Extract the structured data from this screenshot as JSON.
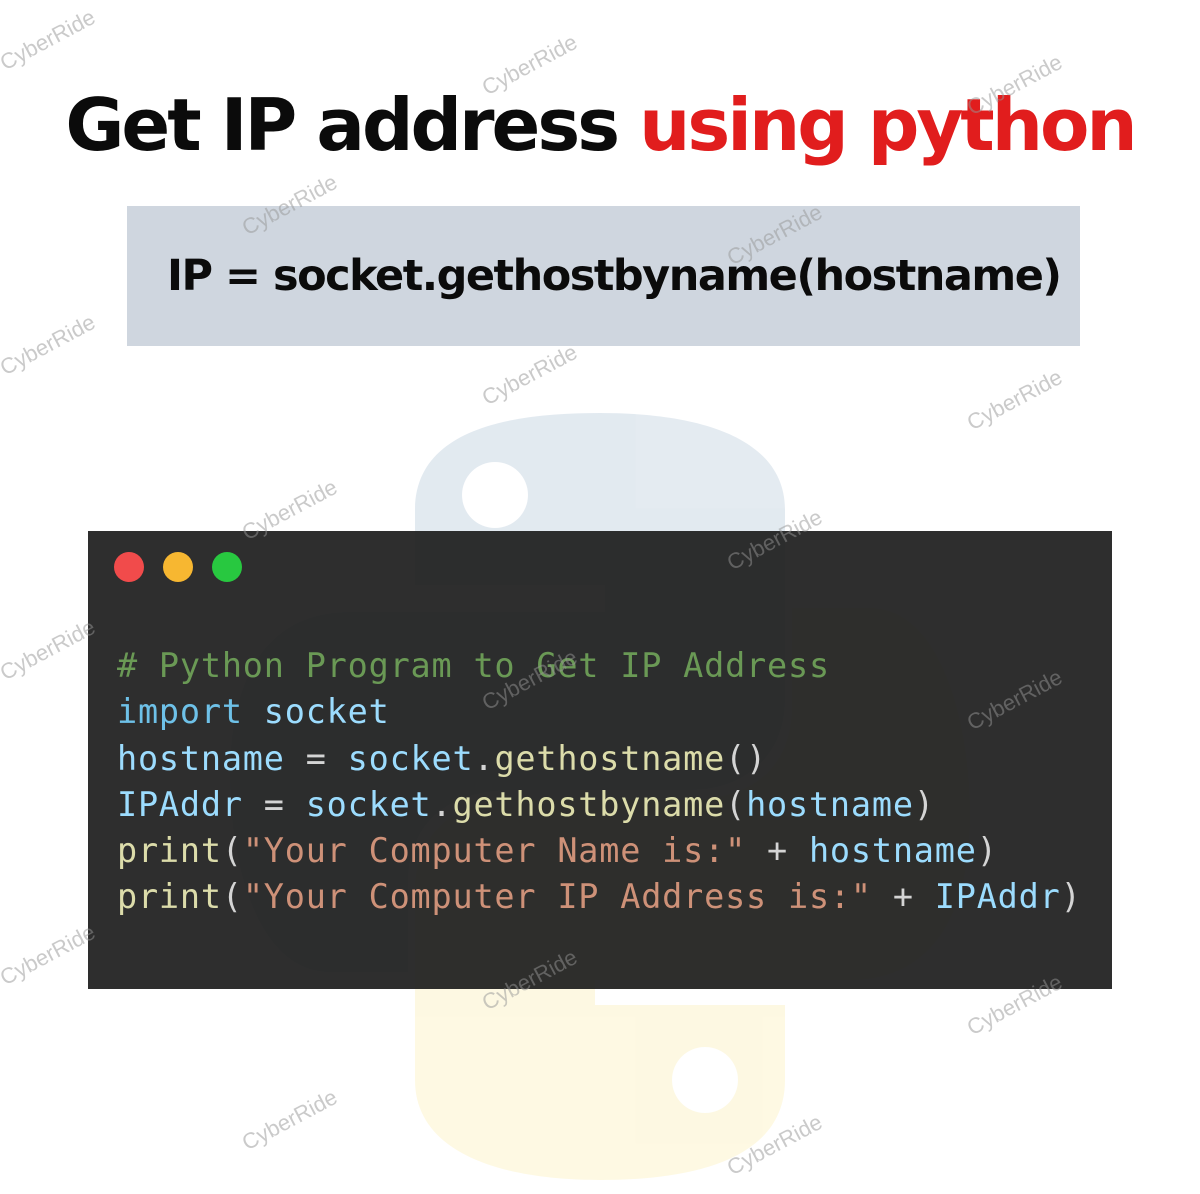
{
  "title": {
    "main": "Get IP address",
    "accent": "using python"
  },
  "formula": "IP = socket.gethostbyname(hostname)",
  "editor": {
    "code": [
      [
        {
          "t": "# Python Program to Get IP Address",
          "c": "cm"
        }
      ],
      [
        {
          "t": "import",
          "c": "kw"
        },
        {
          "t": " ",
          "c": "op"
        },
        {
          "t": "socket",
          "c": "va"
        }
      ],
      [
        {
          "t": "hostname",
          "c": "va"
        },
        {
          "t": " = ",
          "c": "op"
        },
        {
          "t": "socket",
          "c": "va"
        },
        {
          "t": ".",
          "c": "op"
        },
        {
          "t": "gethostname",
          "c": "fn"
        },
        {
          "t": "()",
          "c": "op"
        }
      ],
      [
        {
          "t": "IPAddr",
          "c": "va"
        },
        {
          "t": " = ",
          "c": "op"
        },
        {
          "t": "socket",
          "c": "va"
        },
        {
          "t": ".",
          "c": "op"
        },
        {
          "t": "gethostbyname",
          "c": "fn"
        },
        {
          "t": "(",
          "c": "op"
        },
        {
          "t": "hostname",
          "c": "va"
        },
        {
          "t": ")",
          "c": "op"
        }
      ],
      [
        {
          "t": "print",
          "c": "fn"
        },
        {
          "t": "(",
          "c": "op"
        },
        {
          "t": "\"Your Computer Name is:\"",
          "c": "st"
        },
        {
          "t": " + ",
          "c": "op"
        },
        {
          "t": "hostname",
          "c": "va"
        },
        {
          "t": ")",
          "c": "op"
        }
      ],
      [
        {
          "t": "print",
          "c": "fn"
        },
        {
          "t": "(",
          "c": "op"
        },
        {
          "t": "\"Your Computer IP Address is:\"",
          "c": "st"
        },
        {
          "t": " + ",
          "c": "op"
        },
        {
          "t": "IPAddr",
          "c": "va"
        },
        {
          "t": ")",
          "c": "op"
        }
      ]
    ]
  },
  "watermark": "CyberRide",
  "colors": {
    "accent": "#e11d1d",
    "box": "#cfd6df",
    "editor_bg": "#1e1e1e",
    "python_blue": "#3d6e9e",
    "python_yellow": "#f5d53c"
  },
  "icons": [
    "close-dot",
    "minimize-dot",
    "maximize-dot",
    "python-logo"
  ]
}
